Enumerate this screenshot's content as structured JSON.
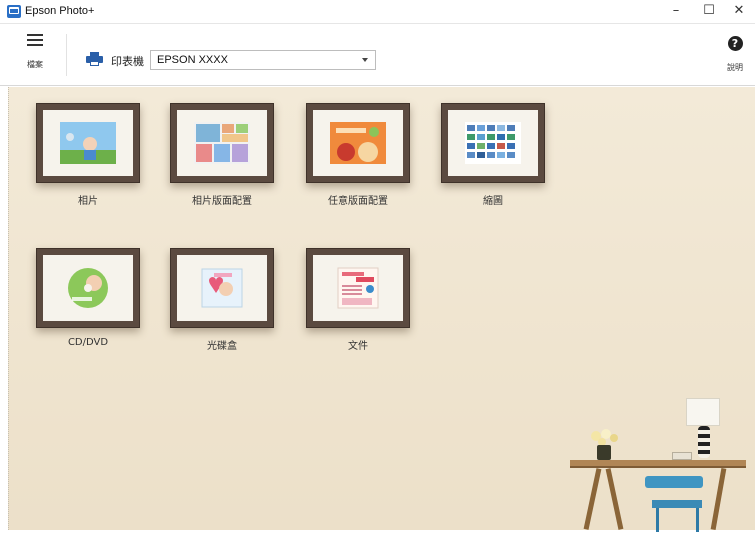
{
  "window": {
    "title": "Epson Photo+",
    "minimize": "–",
    "maximize": "☐",
    "close": "✕"
  },
  "toolbar": {
    "menu_label": "檔案",
    "printer_label": "印表機",
    "printer_value": "EPSON XXXX",
    "help_label": "說明",
    "help_symbol": "?"
  },
  "tiles": [
    {
      "label": "相片"
    },
    {
      "label": "相片版面配置"
    },
    {
      "label": "任意版面配置"
    },
    {
      "label": "縮圖"
    },
    {
      "label": "CD/DVD"
    },
    {
      "label": "光碟盒"
    },
    {
      "label": "文件"
    }
  ],
  "colors": {
    "accent": "#2a6fc6",
    "frame": "#5b4a40",
    "wall": "#f0e6d2"
  }
}
